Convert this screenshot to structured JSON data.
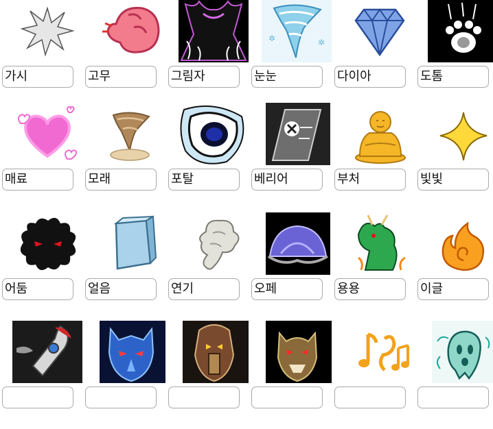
{
  "rows": [
    [
      {
        "label": "가시",
        "icon": "spike-icon"
      },
      {
        "label": "고무",
        "icon": "rubber-fist-icon"
      },
      {
        "label": "그림자",
        "icon": "shadow-icon"
      },
      {
        "label": "눈눈",
        "icon": "snow-tornado-icon"
      },
      {
        "label": "다이아",
        "icon": "diamond-icon"
      },
      {
        "label": "도톰",
        "icon": "paw-icon"
      }
    ],
    [
      {
        "label": "매료",
        "icon": "heart-icon"
      },
      {
        "label": "모래",
        "icon": "sand-tornado-icon"
      },
      {
        "label": "포탈",
        "icon": "portal-icon"
      },
      {
        "label": "베리어",
        "icon": "barrier-icon"
      },
      {
        "label": "부처",
        "icon": "buddha-icon"
      },
      {
        "label": "빛빛",
        "icon": "light-star-icon"
      }
    ],
    [
      {
        "label": "어둠",
        "icon": "darkness-icon"
      },
      {
        "label": "얼음",
        "icon": "ice-cube-icon"
      },
      {
        "label": "연기",
        "icon": "smoke-icon"
      },
      {
        "label": "오페",
        "icon": "dome-icon"
      },
      {
        "label": "용용",
        "icon": "dragon-icon"
      },
      {
        "label": "이글",
        "icon": "flame-icon"
      }
    ],
    [
      {
        "label": "",
        "icon": "rocket-icon"
      },
      {
        "label": "",
        "icon": "blue-beast-icon"
      },
      {
        "label": "",
        "icon": "armored-beast-icon"
      },
      {
        "label": "",
        "icon": "demon-mask-icon"
      },
      {
        "label": "",
        "icon": "music-notes-icon"
      },
      {
        "label": "",
        "icon": "ghost-icon"
      }
    ]
  ]
}
